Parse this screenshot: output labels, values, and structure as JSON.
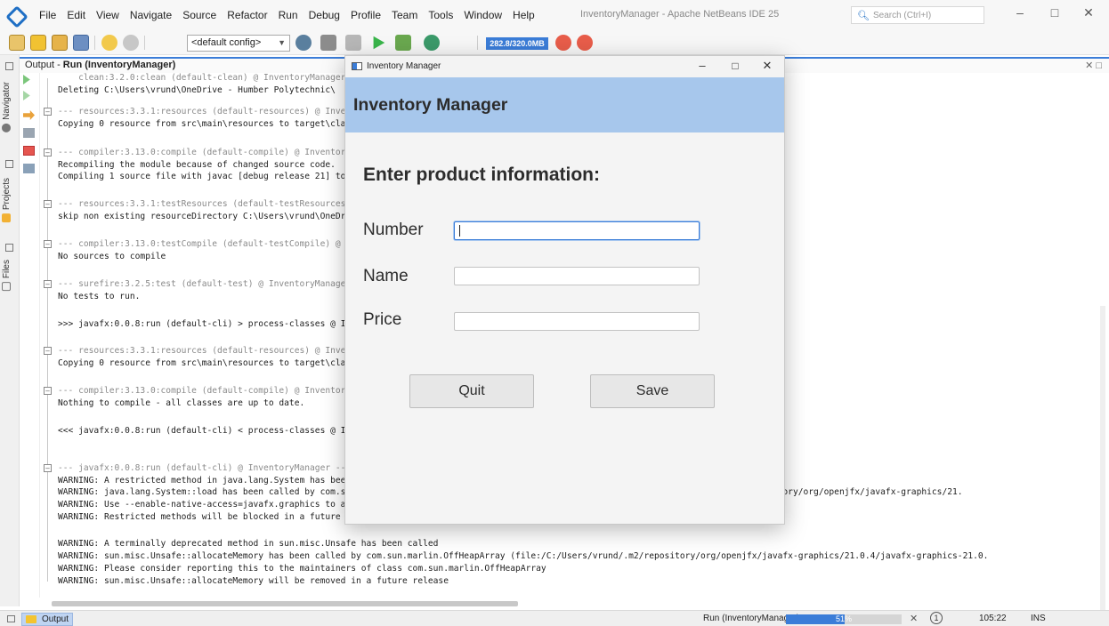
{
  "menubar": {
    "items": [
      "File",
      "Edit",
      "View",
      "Navigate",
      "Source",
      "Refactor",
      "Run",
      "Debug",
      "Profile",
      "Team",
      "Tools",
      "Window",
      "Help"
    ],
    "window_title": "InventoryManager - Apache NetBeans IDE 25",
    "search_placeholder": "Search (Ctrl+I)"
  },
  "toolbar": {
    "config_value": "<default config>",
    "memory_indicator": "282.8/320.0MB"
  },
  "side_panel": {
    "tabs": [
      "Navigator",
      "Projects",
      "Files"
    ]
  },
  "output": {
    "title_prefix": "Output - ",
    "title_bold": "Run (InventoryManager)",
    "lines": [
      {
        "text": "    clean:3.2.0:clean (default-clean) @ InventoryManager ---",
        "gray": true
      },
      {
        "text": "Deleting C:\\Users\\vrund\\OneDrive - Humber Polytechnic\\",
        "gray": false
      },
      {
        "text": "--- resources:3.3.1:resources (default-resources) @ InventoryManager ---",
        "gray": true
      },
      {
        "text": "Copying 0 resource from src\\main\\resources to target\\classes",
        "gray": false
      },
      {
        "text": "--- compiler:3.13.0:compile (default-compile) @ InventoryManager ---",
        "gray": true
      },
      {
        "text": "Recompiling the module because of changed source code.",
        "gray": false
      },
      {
        "text": "Compiling 1 source file with javac [debug release 21] to target\\classes",
        "gray": false
      },
      {
        "text": "--- resources:3.3.1:testResources (default-testResources) @ InventoryManager ---",
        "gray": true
      },
      {
        "text": "skip non existing resourceDirectory C:\\Users\\vrund\\OneDrive - Humber Polytechnic\\Documents\\NetBeansProjects\\JavaFX\\src\\test\\resources",
        "gray": false
      },
      {
        "text": "--- compiler:3.13.0:testCompile (default-testCompile) @ InventoryManager ---",
        "gray": true
      },
      {
        "text": "No sources to compile",
        "gray": false
      },
      {
        "text": "--- surefire:3.2.5:test (default-test) @ InventoryManager ---",
        "gray": true
      },
      {
        "text": "No tests to run.",
        "gray": false
      },
      {
        "text": ">>> javafx:0.0.8:run (default-cli) > process-classes @ InventoryManager >>>",
        "gray": false
      },
      {
        "text": "--- resources:3.3.1:resources (default-resources) @ InventoryManager ---",
        "gray": true
      },
      {
        "text": "Copying 0 resource from src\\main\\resources to target\\classes",
        "gray": false
      },
      {
        "text": "--- compiler:3.13.0:compile (default-compile) @ InventoryManager ---",
        "gray": true
      },
      {
        "text": "Nothing to compile - all classes are up to date.",
        "gray": false
      },
      {
        "text": "<<< javafx:0.0.8:run (default-cli) < process-classes @ InventoryManager <<<",
        "gray": false
      },
      {
        "text": "--- javafx:0.0.8:run (default-cli) @ InventoryManager ---",
        "gray": true
      },
      {
        "text": "WARNING: A restricted method in java.lang.System has been called",
        "gray": false
      },
      {
        "text": "WARNING: java.lang.System::load has been called by com.sun.glass.utils.NativeLibLoader in an unnamed module (file:/C:/Users/vrund/.m2/repository/org/openjfx/javafx-graphics/21.",
        "gray": false
      },
      {
        "text": "WARNING: Use --enable-native-access=javafx.graphics to avoid a warning for callers in this module",
        "gray": false
      },
      {
        "text": "WARNING: Restricted methods will be blocked in a future release unless native access is enabled",
        "gray": false
      },
      {
        "text": "WARNING: A terminally deprecated method in sun.misc.Unsafe has been called",
        "gray": false
      },
      {
        "text": "WARNING: sun.misc.Unsafe::allocateMemory has been called by com.sun.marlin.OffHeapArray (file:/C:/Users/vrund/.m2/repository/org/openjfx/javafx-graphics/21.0.4/javafx-graphics-21.0.",
        "gray": false
      },
      {
        "text": "WARNING: Please consider reporting this to the maintainers of class com.sun.marlin.OffHeapArray",
        "gray": false
      },
      {
        "text": "WARNING: sun.misc.Unsafe::allocateMemory will be removed in a future release",
        "gray": false
      }
    ]
  },
  "dialog": {
    "window_title": "Inventory Manager",
    "banner_title": "Inventory Manager",
    "heading": "Enter product information:",
    "fields": [
      {
        "label": "Number",
        "value": ""
      },
      {
        "label": "Name",
        "value": ""
      },
      {
        "label": "Price",
        "value": ""
      }
    ],
    "quit_label": "Quit",
    "save_label": "Save"
  },
  "statusbar": {
    "output_tab": "Output",
    "run_label": "Run (InventoryManager)",
    "progress_percent": 51,
    "progress_text": "51%",
    "notifications": "1",
    "position": "105:22",
    "mode": "INS"
  },
  "colors": {
    "accent": "#3b7dd8",
    "dialog_banner": "#a7c7ec"
  }
}
